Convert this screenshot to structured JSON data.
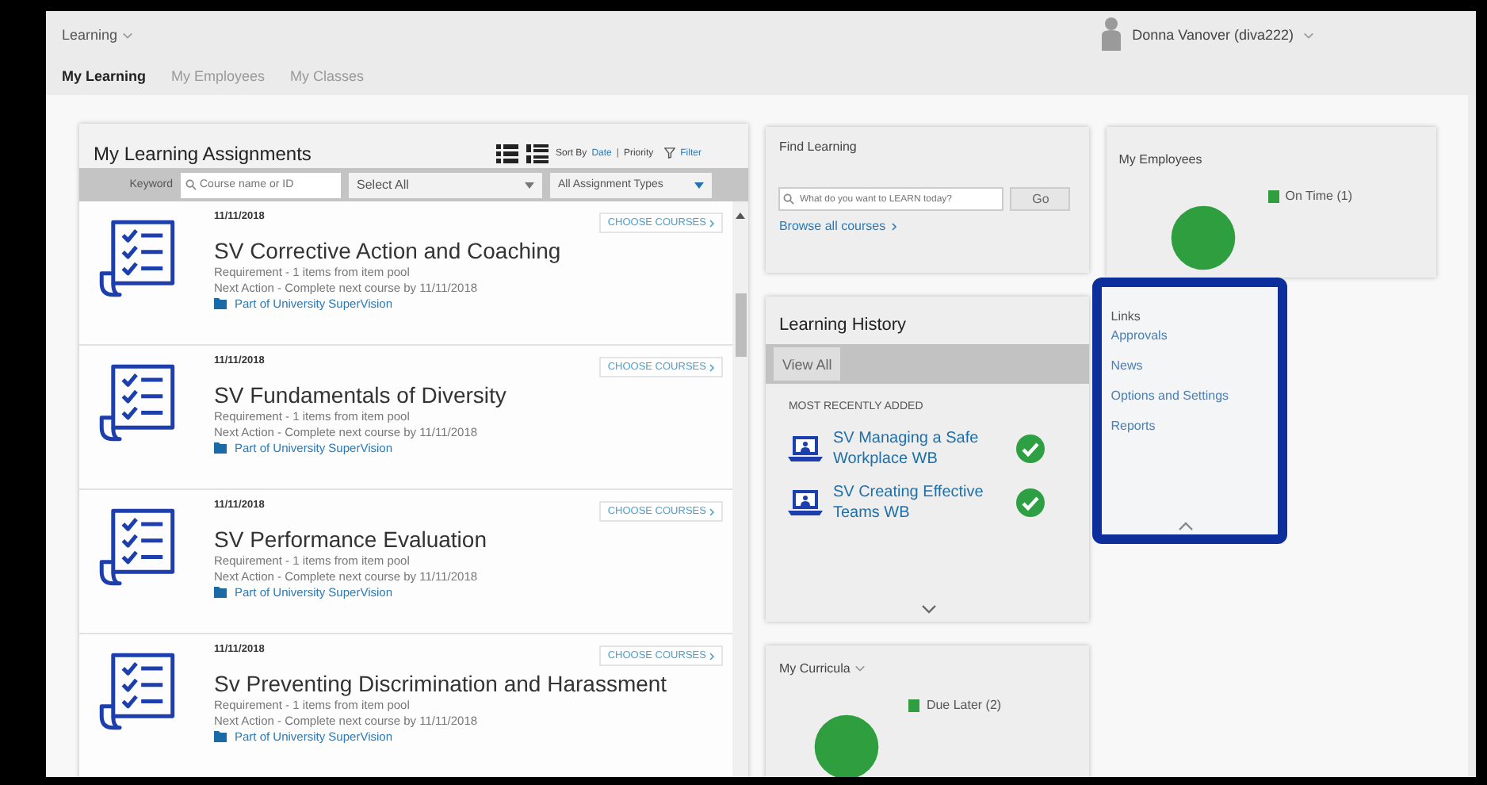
{
  "header": {
    "app_menu": "Learning",
    "user": "Donna Vanover (diva222)"
  },
  "tabs": [
    {
      "label": "My Learning",
      "selected": true
    },
    {
      "label": "My Employees",
      "selected": false
    },
    {
      "label": "My Classes",
      "selected": false
    }
  ],
  "assignments": {
    "title": "My Learning Assignments",
    "sort_label": "Sort By",
    "sort_separator": "|",
    "sort_options": [
      {
        "label": "Date",
        "selected": true
      },
      {
        "label": "Priority",
        "selected": false
      }
    ],
    "filter": "Filter",
    "keyword_label": "Keyword",
    "keyword_placeholder": "Course name or ID",
    "select_1": "Select All",
    "select_2": "All Assignment Types",
    "items": [
      {
        "date": "11/11/2018",
        "title": "SV Corrective Action and Coaching",
        "requirement": "Requirement - 1 items from item pool",
        "next_action": "Next Action - Complete next course by 11/11/2018",
        "part_of": "Part of University SuperVision",
        "button": "CHOOSE COURSES"
      },
      {
        "date": "11/11/2018",
        "title": "SV Fundamentals of Diversity",
        "requirement": "Requirement - 1 items from item pool",
        "next_action": "Next Action - Complete next course by 11/11/2018",
        "part_of": "Part of University SuperVision",
        "button": "CHOOSE COURSES"
      },
      {
        "date": "11/11/2018",
        "title": "SV Performance Evaluation",
        "requirement": "Requirement - 1 items from item pool",
        "next_action": "Next Action - Complete next course by 11/11/2018",
        "part_of": "Part of University SuperVision",
        "button": "CHOOSE COURSES"
      },
      {
        "date": "11/11/2018",
        "title": "Sv Preventing Discrimination and Harassment",
        "requirement": "Requirement - 1 items from item pool",
        "next_action": "Next Action - Complete next course by 11/11/2018",
        "part_of": "Part of University SuperVision",
        "button": "CHOOSE COURSES"
      }
    ]
  },
  "find_learning": {
    "title": "Find Learning",
    "placeholder": "What do you want to LEARN today?",
    "button": "Go",
    "browse": "Browse all courses"
  },
  "learning_history": {
    "title": "Learning History",
    "view_all": "View All",
    "section": "MOST RECENTLY ADDED",
    "items": [
      {
        "title": "SV Managing a Safe Workplace WB",
        "completed": true
      },
      {
        "title": "SV Creating Effective Teams WB",
        "completed": true
      }
    ]
  },
  "my_curricula": {
    "title": "My Curricula",
    "legend": [
      {
        "label": "Due Later (2)",
        "color": "#2e9e3e"
      }
    ]
  },
  "my_employees": {
    "title": "My Employees",
    "legend": [
      {
        "label": "On Time (1)",
        "color": "#2e9e3e"
      }
    ]
  },
  "links": {
    "title": "Links",
    "items": [
      "Approvals",
      "News",
      "Options and Settings",
      "Reports"
    ]
  }
}
